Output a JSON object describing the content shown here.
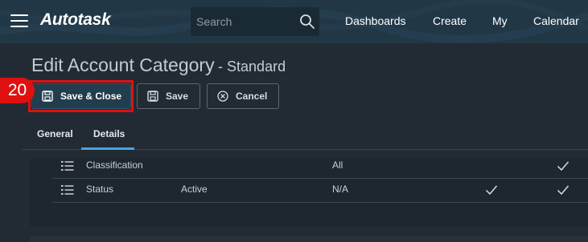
{
  "header": {
    "logo_text": "Autotask",
    "search": {
      "placeholder": "Search",
      "value": ""
    },
    "nav": [
      "Dashboards",
      "Create",
      "My",
      "Calendar"
    ]
  },
  "page": {
    "title": "Edit Account Category",
    "subtitle": "- Standard"
  },
  "toolbar": {
    "save_close_label": "Save & Close",
    "save_label": "Save",
    "cancel_label": "Cancel"
  },
  "step_marker": "20",
  "tabs": [
    {
      "label": "General",
      "active": false
    },
    {
      "label": "Details",
      "active": true
    }
  ],
  "rows": [
    {
      "name": "Classification",
      "state": "",
      "value": "All",
      "check1": false,
      "check2": true
    },
    {
      "name": "Status",
      "state": "Active",
      "value": "N/A",
      "check1": true,
      "check2": true
    }
  ],
  "colors": {
    "topbar": "#213746",
    "accent": "#4aa3df",
    "highlight": "#e01010",
    "background": "#222b33"
  }
}
